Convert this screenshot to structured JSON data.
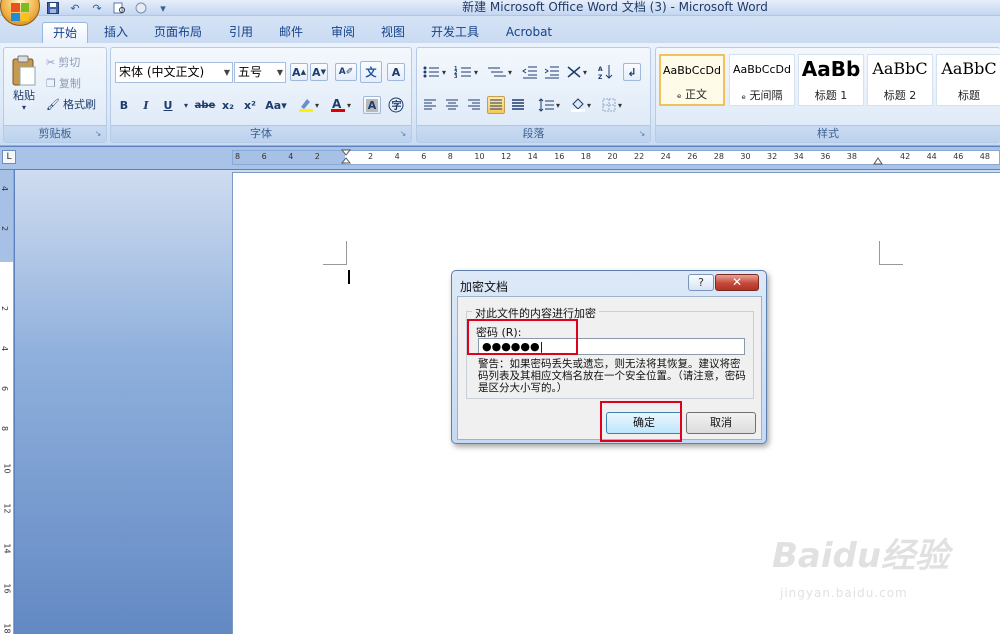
{
  "window": {
    "title": "新建 Microsoft Office Word 文档 (3) - Microsoft Word"
  },
  "tabs": [
    "开始",
    "插入",
    "页面布局",
    "引用",
    "邮件",
    "审阅",
    "视图",
    "开发工具",
    "Acrobat"
  ],
  "active_tab": "开始",
  "ribbon": {
    "clipboard": {
      "label": "剪贴板",
      "paste": "粘贴",
      "cut": "剪切",
      "copy": "复制",
      "format_painter": "格式刷"
    },
    "font": {
      "label": "字体",
      "font_name": "宋体 (中文正文)",
      "font_size": "五号"
    },
    "paragraph": {
      "label": "段落"
    },
    "styles": {
      "label": "样式",
      "items": [
        {
          "sample": "AaBbCcDd",
          "name": "ₑ 正文"
        },
        {
          "sample": "AaBbCcDd",
          "name": "ₑ 无间隔"
        },
        {
          "sample": "AaBb",
          "name": "标题 1"
        },
        {
          "sample": "AaBbC",
          "name": "标题 2"
        },
        {
          "sample": "AaBbC",
          "name": "标题"
        }
      ]
    }
  },
  "ruler": {
    "corner": "L",
    "ticks": [
      "8",
      "6",
      "4",
      "2",
      "",
      "2",
      "4",
      "6",
      "8",
      "10",
      "12",
      "14",
      "16",
      "18",
      "20",
      "22",
      "24",
      "26",
      "28",
      "30",
      "32",
      "34",
      "36",
      "38",
      "",
      "42",
      "44",
      "46",
      "48"
    ],
    "vticks": [
      "4",
      "2",
      "",
      "2",
      "4",
      "6",
      "8",
      "10",
      "12",
      "14",
      "16",
      "18"
    ]
  },
  "dialog": {
    "title": "加密文档",
    "help": "?",
    "close": "✕",
    "group_label": "对此文件的内容进行加密",
    "password_label": "密码 (R):",
    "password_value": "●●●●●●|",
    "warning": "警告：如果密码丢失或遗忘，则无法将其恢复。建议将密码列表及其相应文档名放在一个安全位置。（请注意，密码是区分大小写的。）",
    "ok": "确定",
    "cancel": "取消"
  },
  "watermark": {
    "logo": "Baidu经验",
    "url": "jingyan.baidu.com"
  }
}
